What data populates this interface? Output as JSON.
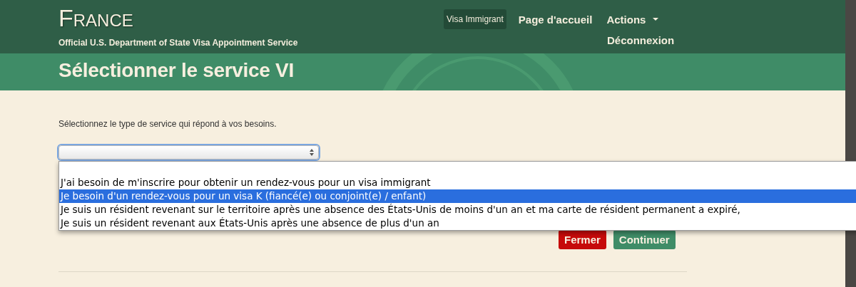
{
  "header": {
    "brand": "France",
    "subtitle": "Official U.S. Department of State Visa Appointment Service"
  },
  "nav": [
    {
      "label": "Visa Immigrant",
      "selected": true
    },
    {
      "label": "Page d'accueil",
      "selected": false
    },
    {
      "label": "Actions",
      "selected": false,
      "has_menu": true
    },
    {
      "label": "Déconnexion",
      "selected": false
    }
  ],
  "page_title": "Sélectionner le service VI",
  "prompt": "Sélectionnez le type de service qui répond à vos besoins.",
  "select": {
    "expanded": true,
    "options": [
      {
        "label": "J'ai besoin de m'inscrire pour obtenir un rendez-vous pour un visa immigrant",
        "selected": false
      },
      {
        "label": "Je besoin d'un rendez-vous pour un visa K (fiancé(e) ou conjoint(e) / enfant)",
        "selected": true
      },
      {
        "label": "Je suis un résident revenant sur le territoire après une absence des États-Unis de moins d'un an et ma carte de résident permanent a expiré,",
        "selected": false
      },
      {
        "label": "Je suis un résident revenant aux États-Unis après une absence de plus d'un an",
        "selected": false
      }
    ]
  },
  "buttons": [
    {
      "label": "Fermer",
      "kind": "danger"
    },
    {
      "label": "Continuer",
      "kind": "primary"
    }
  ]
}
